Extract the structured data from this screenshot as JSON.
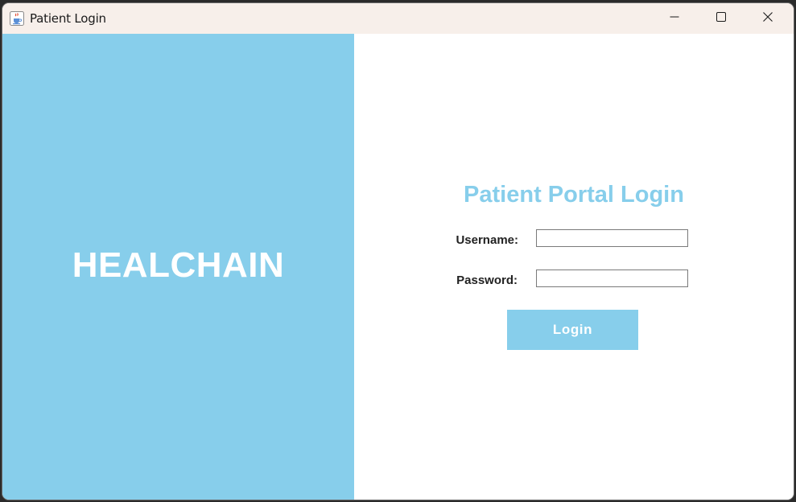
{
  "window": {
    "title": "Patient Login",
    "icon": "java-cup-icon",
    "controls": [
      "minimize-icon",
      "maximize-icon",
      "close-icon"
    ]
  },
  "left_panel": {
    "brand": "HEALCHAIN",
    "background_color": "#87ceeb"
  },
  "login_form": {
    "title": "Patient Portal Login",
    "username_label": "Username:",
    "username_value": "",
    "password_label": "Password:",
    "password_value": "",
    "login_button": "Login",
    "accent_color": "#87ceeb"
  }
}
